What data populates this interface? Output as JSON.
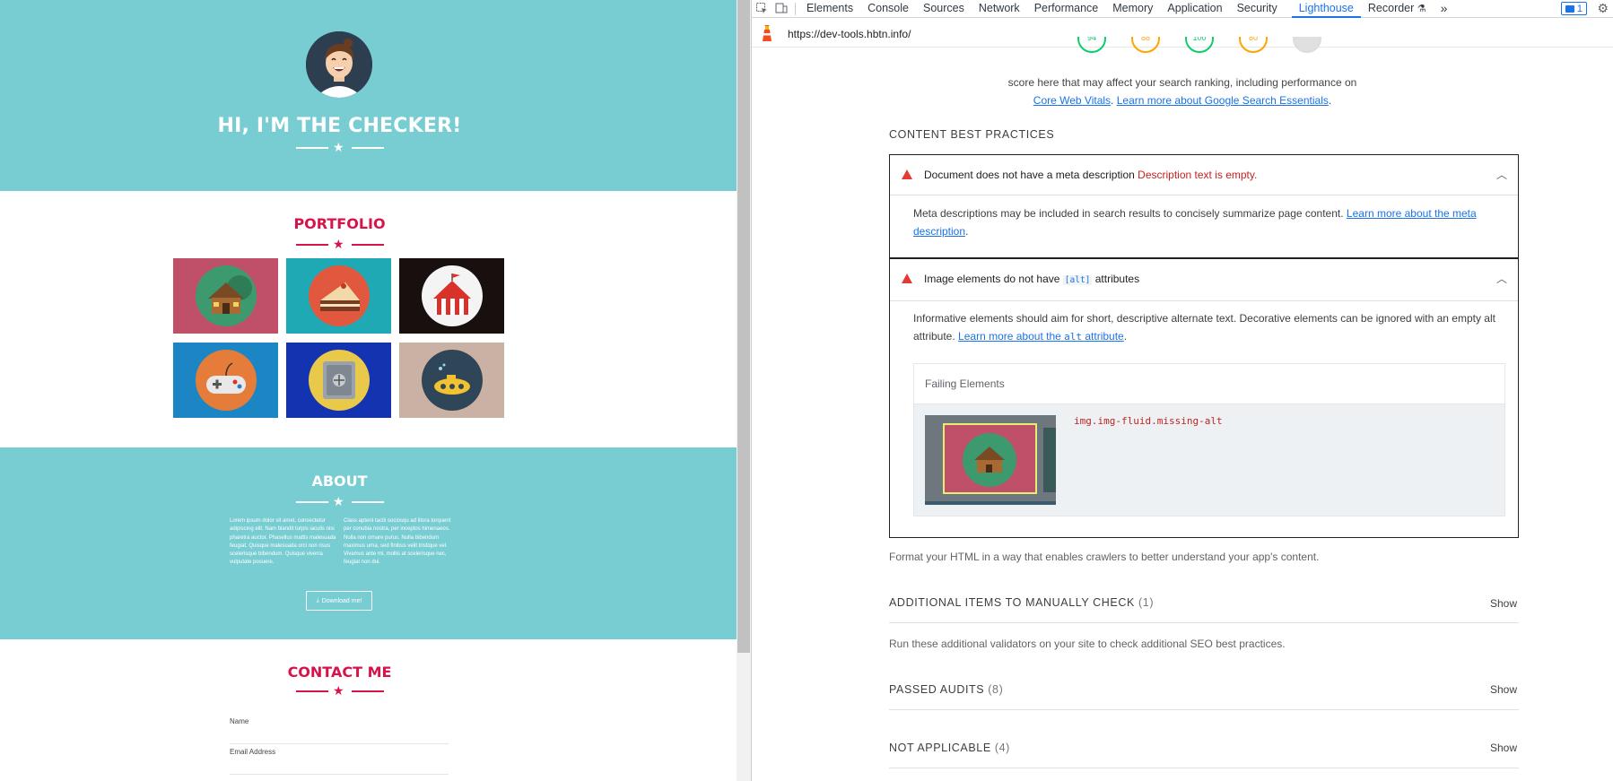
{
  "site": {
    "hero_title": "HI, I'M THE CHECKER!",
    "portfolio_title": "PORTFOLIO",
    "portfolio_tiles": [
      {
        "name": "cabin",
        "bg": "#c0506a",
        "disc": "#3d9a6f"
      },
      {
        "name": "cake",
        "bg": "#1fa9b5",
        "disc": "#e2583e"
      },
      {
        "name": "circus-tent",
        "bg": "#17100f",
        "disc": "#f4f4f4"
      },
      {
        "name": "game-controller",
        "bg": "#1c86c5",
        "disc": "#e57c3a"
      },
      {
        "name": "safe",
        "bg": "#1433b0",
        "disc": "#e8c94a"
      },
      {
        "name": "submarine",
        "bg": "#c9b1a4",
        "disc": "#2f4658"
      }
    ],
    "about_title": "ABOUT",
    "about_col1": "Lorem ipsum dolor sit amet, consectetur adipiscing elit. Nam blandit turpis iaculis nisi pharetra auctor. Phasellus mattis malesuada feugiat. Quisque malesuada orci non risus scelerisque bibendum. Quisque viverra vulputate posuere.",
    "about_col2": "Class aptent taciti sociosqu ad litora torquent per conubia nostra, per inceptos himenaeos. Nulla non ornare purus. Nulla bibendum maximus urna, sed finibus velit tristique vel. Vivamus ante mi, mollis at scelerisque nec, feugiat non dui.",
    "download_label": "Download me!",
    "contact_title": "CONTACT ME",
    "fields": [
      "Name",
      "Email Address"
    ]
  },
  "devtools": {
    "tabs": [
      "Elements",
      "Console",
      "Sources",
      "Network",
      "Performance",
      "Memory",
      "Application",
      "Security",
      "Lighthouse",
      "Recorder"
    ],
    "active_tab": "Lighthouse",
    "issues_count": "1",
    "url": "https://dev-tools.hbtn.info/",
    "gauges": [
      {
        "value": "94",
        "color": "#0cce6b"
      },
      {
        "value": "88",
        "color": "#ffa400"
      },
      {
        "value": "100",
        "color": "#0cce6b"
      },
      {
        "value": "80",
        "color": "#ffa400"
      },
      {
        "value": "",
        "color": "#cccccc"
      }
    ],
    "seo_desc_line1": "score here that may affect your search ranking, including performance on",
    "seo_link1": "Core Web Vitals",
    "seo_link2": "Learn more about Google Search Essentials",
    "content_heading": "CONTENT BEST PRACTICES",
    "audits": [
      {
        "title": "Document does not have a meta description",
        "status": "Description text is empty.",
        "body": "Meta descriptions may be included in search results to concisely summarize page content.",
        "link": "Learn more about the meta description"
      },
      {
        "title_pre": "Image elements do not have",
        "title_code": "[alt]",
        "title_post": "attributes",
        "body": "Informative elements should aim for short, descriptive alternate text. Decorative elements can be ignored with an empty alt attribute.",
        "link_pre": "Learn more about the",
        "link_code": "alt",
        "link_post": "attribute",
        "failing_header": "Failing Elements",
        "failing_node": "img.img-fluid.missing-alt"
      }
    ],
    "format_note": "Format your HTML in a way that enables crawlers to better understand your app's content.",
    "manual_heading": "ADDITIONAL ITEMS TO MANUALLY CHECK",
    "manual_count": "(1)",
    "manual_note": "Run these additional validators on your site to check additional SEO best practices.",
    "passed_heading": "PASSED AUDITS",
    "passed_count": "(8)",
    "na_heading": "NOT APPLICABLE",
    "na_count": "(4)",
    "show_label": "Show"
  }
}
